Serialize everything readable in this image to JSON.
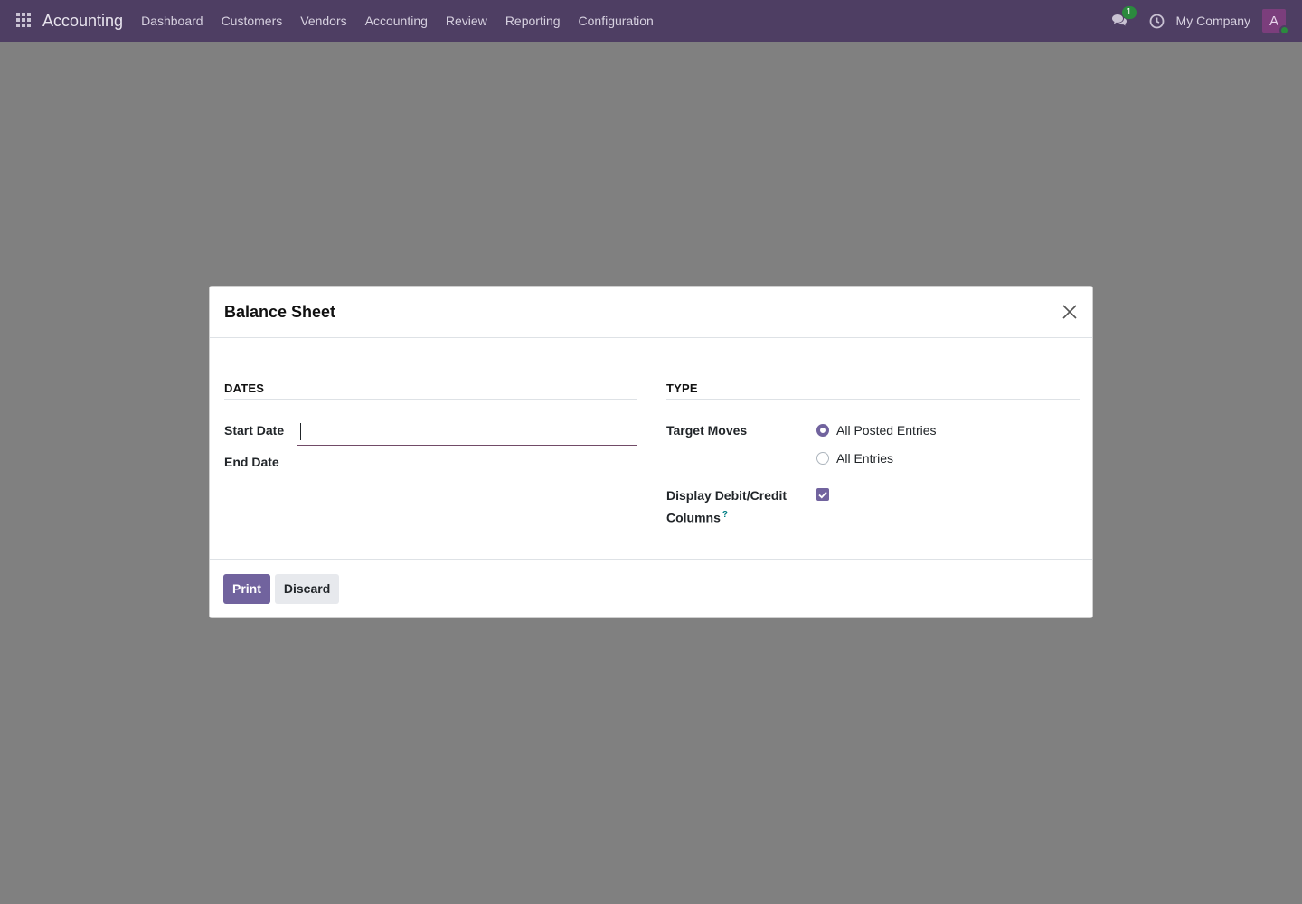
{
  "navbar": {
    "app_name": "Accounting",
    "menu": [
      "Dashboard",
      "Customers",
      "Vendors",
      "Accounting",
      "Review",
      "Reporting",
      "Configuration"
    ],
    "message_count": "1",
    "company": "My Company",
    "avatar_initial": "A"
  },
  "dialog": {
    "title": "Balance Sheet",
    "dates_section": "DATES",
    "start_date_label": "Start Date",
    "start_date_value": "",
    "end_date_label": "End Date",
    "type_section": "TYPE",
    "target_moves_label": "Target Moves",
    "target_moves_options": [
      {
        "label": "All Posted Entries",
        "selected": true
      },
      {
        "label": "All Entries",
        "selected": false
      }
    ],
    "display_debit_credit_label": "Display Debit/Credit Columns",
    "display_debit_credit_help": "?",
    "display_debit_credit_checked": true,
    "print_label": "Print",
    "discard_label": "Discard"
  },
  "colors": {
    "navbar_bg": "#4e3e63",
    "primary": "#71639e",
    "backdrop": "#808080"
  }
}
